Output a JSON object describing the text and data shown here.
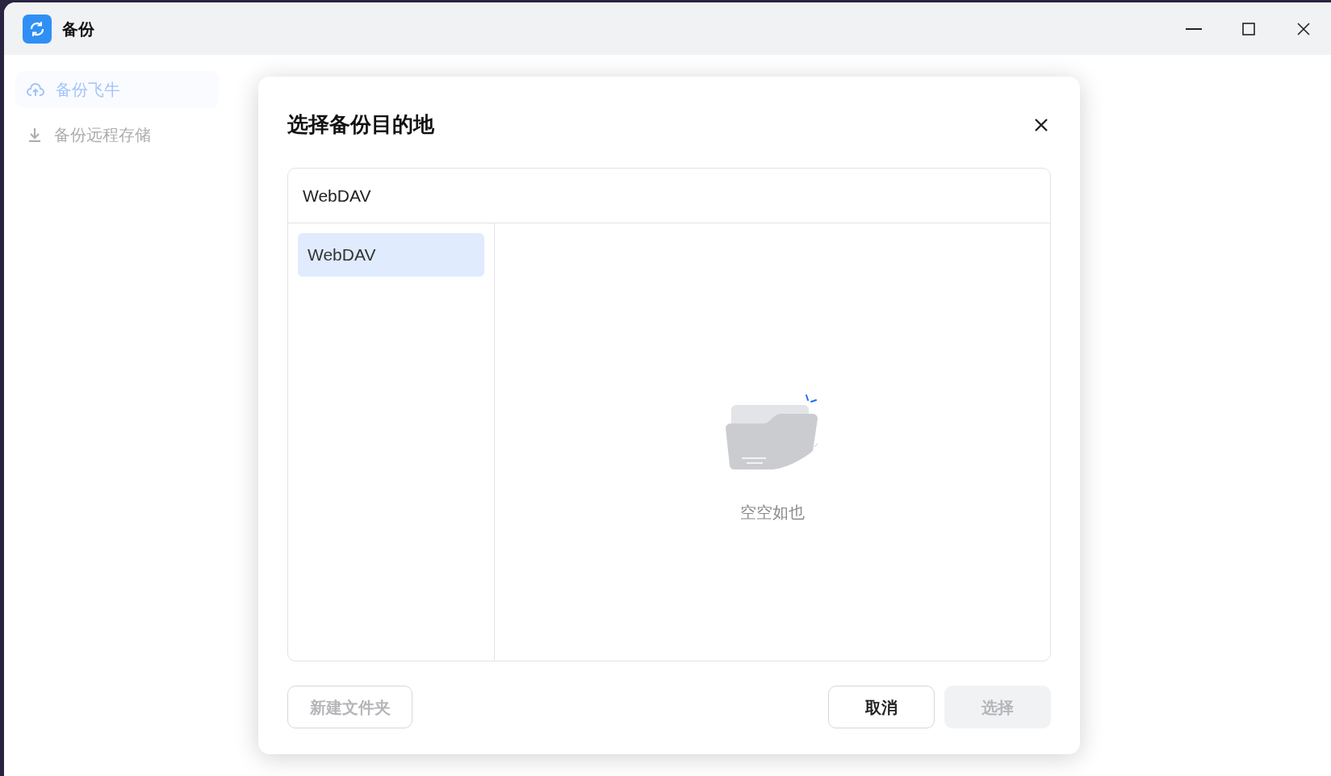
{
  "window": {
    "title": "备份"
  },
  "sidebar": {
    "items": [
      {
        "label": "备份飞牛",
        "kind": "cloud-upload",
        "selected": true
      },
      {
        "label": "备份远程存储",
        "kind": "download",
        "selected": false
      }
    ]
  },
  "dialog": {
    "title": "选择备份目的地",
    "path": "WebDAV",
    "locations": [
      {
        "label": "WebDAV",
        "selected": true
      }
    ],
    "empty_text": "空空如也",
    "buttons": [
      {
        "label": "新建文件夹",
        "kind": "outline",
        "disabled": true
      },
      {
        "label": "取消",
        "kind": "outline",
        "disabled": false
      },
      {
        "label": "选择",
        "kind": "primary",
        "disabled": true
      }
    ]
  }
}
